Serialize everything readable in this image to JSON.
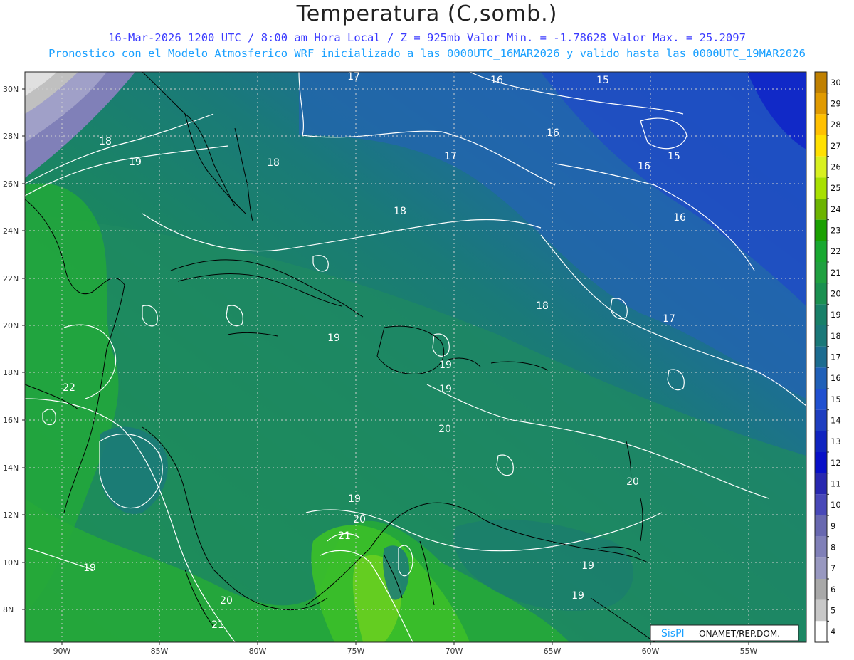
{
  "header": {
    "title": "Temperatura (C,somb.)",
    "line1": "16-Mar-2026  1200 UTC / 8:00 am Hora Local / Z = 925mb   Valor Min. = -1.78628  Valor Max. = 25.2097",
    "line2": "Pronostico con el Modelo Atmosferico WRF inicializado a las 0000UTC_16MAR2026 y valido hasta las  0000UTC_19MAR2026"
  },
  "map": {
    "lat_labels": [
      "30N",
      "28N",
      "26N",
      "24N",
      "22N",
      "20N",
      "18N",
      "16N",
      "14N",
      "12N",
      "10N",
      "8N"
    ],
    "lon_labels": [
      "90W",
      "85W",
      "80W",
      "75W",
      "70W",
      "65W",
      "60W",
      "55W"
    ],
    "contour_labels": [
      "17",
      "16",
      "15",
      "18",
      "19",
      "16",
      "17",
      "18",
      "16",
      "15",
      "18",
      "16",
      "18",
      "17",
      "19",
      "19",
      "19",
      "22",
      "20",
      "19",
      "20",
      "21",
      "20",
      "19",
      "19",
      "19",
      "20",
      "21"
    ],
    "credit": {
      "logo": "SisPI",
      "text": "- ONAMET/REP.DOM."
    }
  },
  "colorbar": {
    "labels": [
      "30",
      "29",
      "28",
      "27",
      "26",
      "25",
      "24",
      "23",
      "22",
      "21",
      "20",
      "19",
      "18",
      "17",
      "16",
      "15",
      "14",
      "13",
      "12",
      "11",
      "10",
      "9",
      "8",
      "7",
      "6",
      "5",
      "4"
    ],
    "colors": [
      "#c08000",
      "#e09a00",
      "#ffc000",
      "#ffe000",
      "#d8f020",
      "#a8e000",
      "#6cb400",
      "#1aa000",
      "#18a830",
      "#1fa040",
      "#1a9050",
      "#188068",
      "#1a7878",
      "#1c6c90",
      "#2060b8",
      "#2050d0",
      "#1e3ec0",
      "#1024c0",
      "#0810c8",
      "#2828b0",
      "#4848b8",
      "#6868b0",
      "#8080b8",
      "#9898c0",
      "#a8a8a8",
      "#c8c8c8",
      "#ffffff"
    ]
  }
}
